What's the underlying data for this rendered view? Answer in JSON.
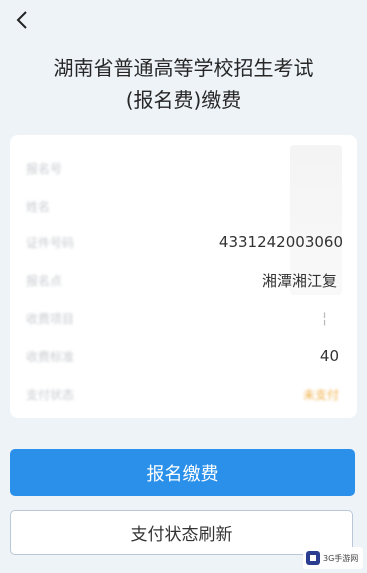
{
  "header": {
    "title_line1": "湖南省普通高等学校招生考试",
    "title_line2": "(报名费)缴费"
  },
  "info": {
    "rows": [
      {
        "label": "报名号",
        "value": ""
      },
      {
        "label": "姓名",
        "value": ""
      },
      {
        "label": "证件号码",
        "value": "4331242003060"
      },
      {
        "label": "报名点",
        "value": "湘潭湘江复"
      },
      {
        "label": "收费项目",
        "value": "¦"
      },
      {
        "label": "收费标准",
        "value": "40"
      },
      {
        "label": "支付状态",
        "value": "未支付"
      }
    ]
  },
  "actions": {
    "pay_label": "报名缴费",
    "refresh_label": "支付状态刷新"
  },
  "watermark": {
    "text": "3G手游网"
  },
  "colors": {
    "accent": "#2a90ea",
    "background": "#eef3f8",
    "status": "#f0b24c"
  }
}
